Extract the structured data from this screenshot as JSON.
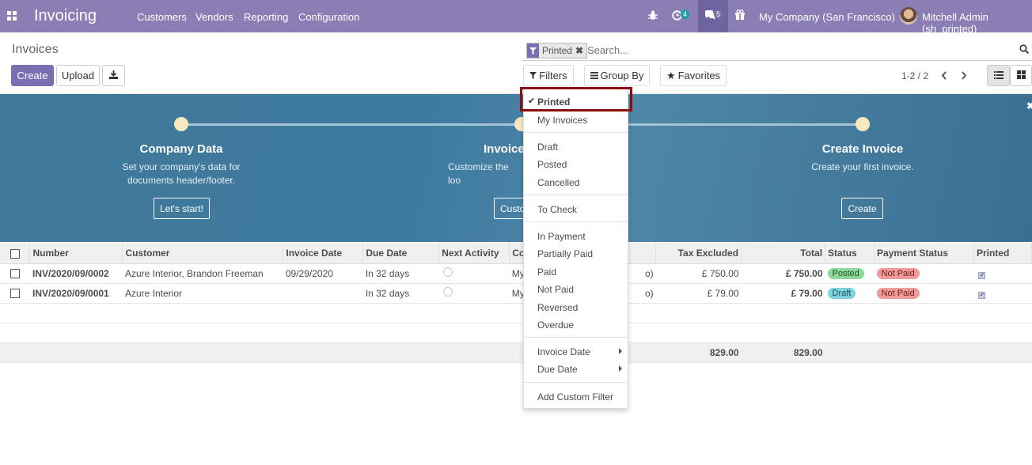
{
  "topbar": {
    "app_title": "Invoicing",
    "menu": [
      "Customers",
      "Vendors",
      "Reporting",
      "Configuration"
    ],
    "activity_count": "4",
    "message_count": "5",
    "company": "My Company (San Francisco)",
    "user": "Mitchell Admin (sh_printed)"
  },
  "control": {
    "breadcrumb": "Invoices",
    "create_label": "Create",
    "upload_label": "Upload",
    "facet_label": "Printed",
    "search_placeholder": "Search...",
    "filters_label": "Filters",
    "groupby_label": "Group By",
    "favorites_label": "Favorites",
    "pager": "1-2 / 2"
  },
  "banner": {
    "steps": [
      {
        "title": "Company Data",
        "desc1": "Set your company's data for",
        "desc2": "documents header/footer.",
        "button": "Let's start!"
      },
      {
        "title": "Invoice",
        "desc1": "Customize the loo",
        "desc2": "",
        "button": "Custo"
      },
      {
        "title": "Create Invoice",
        "desc1": "Create your first invoice.",
        "desc2": "",
        "button": "Create"
      }
    ]
  },
  "table": {
    "headers": [
      "Number",
      "Customer",
      "Invoice Date",
      "Due Date",
      "Next Activity",
      "Co",
      "Tax Excluded",
      "Total",
      "Status",
      "Payment Status",
      "Printed"
    ],
    "rows": [
      {
        "number": "INV/2020/09/0002",
        "customer": "Azure Interior, Brandon Freeman",
        "invoice_date": "09/29/2020",
        "due_date": "In 32 days",
        "company": "My",
        "company_tail": "o)",
        "tax_excluded": "£ 750.00",
        "total": "£ 750.00",
        "status": "Posted",
        "payment_status": "Not Paid"
      },
      {
        "number": "INV/2020/09/0001",
        "customer": "Azure Interior",
        "invoice_date": "",
        "due_date": "In 32 days",
        "company": "My",
        "company_tail": "o)",
        "tax_excluded": "£ 79.00",
        "total": "£ 79.00",
        "status": "Draft",
        "payment_status": "Not Paid"
      }
    ],
    "sum_tax_excluded": "829.00",
    "sum_total": "829.00"
  },
  "filters_menu": {
    "items": [
      "Printed",
      "My Invoices",
      "Draft",
      "Posted",
      "Cancelled",
      "To Check",
      "In Payment",
      "Partially Paid",
      "Paid",
      "Not Paid",
      "Reversed",
      "Overdue",
      "Invoice Date",
      "Due Date",
      "Add Custom Filter"
    ]
  },
  "colors": {
    "navbar": "#8a7eb5",
    "primary": "#7a6fb0",
    "posted_badge": "#8bd89a",
    "draft_badge": "#7fd3e0",
    "not_paid_badge": "#f19a9a",
    "highlight_border": "#8b0f0f"
  }
}
